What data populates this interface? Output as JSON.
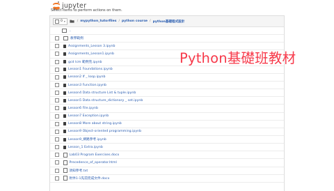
{
  "app": {
    "logo_text": "jupyter",
    "cut_text": "Select items to perform actions on them."
  },
  "toolbar": {
    "selected_count": "0",
    "caret": "▾",
    "breadcrumb": [
      "mypython_tutorfiles",
      "python course",
      "python基礎程式設計"
    ],
    "separator": "/"
  },
  "files": [
    {
      "type": "updir",
      "name": ".."
    },
    {
      "type": "folder",
      "name": "教學範例"
    },
    {
      "type": "notebook",
      "name": "Assignments_Lesson 3.ipynb"
    },
    {
      "type": "notebook",
      "name": "Assignments_Lesson1.ipynb"
    },
    {
      "type": "notebook",
      "name": "gcd lcm 範例完.ipynb"
    },
    {
      "type": "notebook",
      "name": "Lesson1 Foundations.ipynb"
    },
    {
      "type": "notebook",
      "name": "Lesson2 If _ loop.ipynb"
    },
    {
      "type": "notebook",
      "name": "Lesson3 Function.ipynb"
    },
    {
      "type": "notebook",
      "name": "Lesson4 Data structure List & tuple.ipynb"
    },
    {
      "type": "notebook",
      "name": "Lesson5 Data structure_dictionary _ set.ipynb"
    },
    {
      "type": "notebook",
      "name": "Lesson6 File.ipynb"
    },
    {
      "type": "notebook",
      "name": "Lesson7 Exception.ipynb"
    },
    {
      "type": "notebook",
      "name": "Lesson8 More about string.ipynb"
    },
    {
      "type": "notebook",
      "name": "Lesson9 Object-oriented programming.ipynb"
    },
    {
      "type": "notebook",
      "name": "Lesson9_網路參考.ipynb"
    },
    {
      "type": "notebook",
      "name": "Lesson_1 Extra.ipynb"
    },
    {
      "type": "file",
      "name": "Lab03 Program Exercises.docx"
    },
    {
      "type": "file",
      "name": "Precedence_of_operator.html"
    },
    {
      "type": "file",
      "name": "須知參考.txt"
    },
    {
      "type": "file",
      "name": "附件1-1先前完成文件.docx"
    }
  ],
  "overlay_text": "Python基礎班教材",
  "colors": {
    "link": "#2a5db0",
    "overlay": "#f7394a",
    "jupyter_orange": "#f37726"
  }
}
